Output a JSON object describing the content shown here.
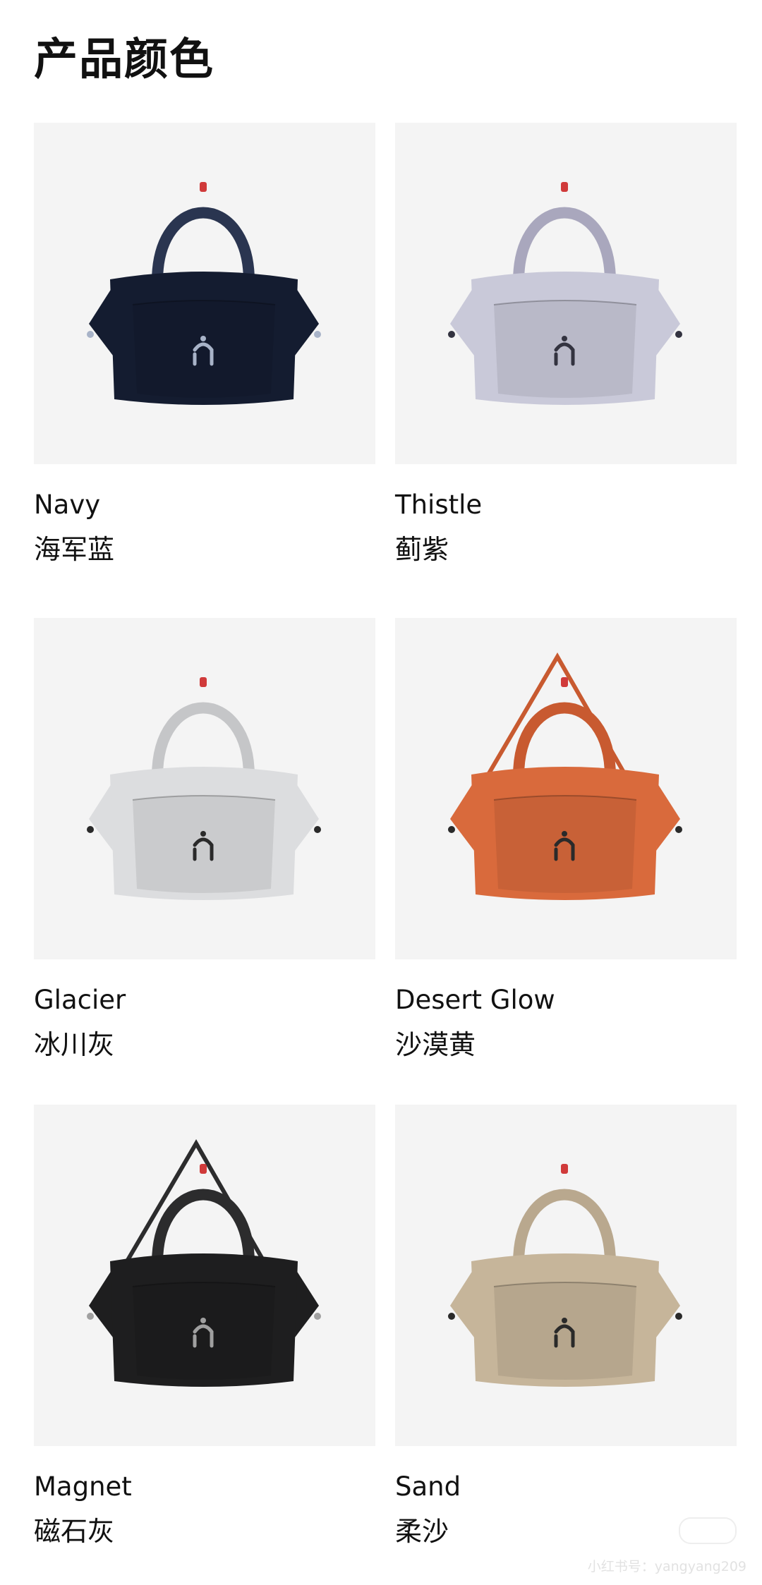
{
  "page": {
    "title": "产品颜色"
  },
  "colors": [
    {
      "name_en": "Navy",
      "name_cn": "海军蓝",
      "icon": "tote-bag-icon",
      "bag_color": "#141c30",
      "handle_color": "#2a3550",
      "accent_color": "#a8b3c8",
      "strap": false
    },
    {
      "name_en": "Thistle",
      "name_cn": "蓟紫",
      "icon": "tote-bag-icon",
      "bag_color": "#c9c9d9",
      "handle_color": "#a9a7bd",
      "accent_color": "#333340",
      "strap": false
    },
    {
      "name_en": "Glacier",
      "name_cn": "冰川灰",
      "icon": "tote-bag-icon",
      "bag_color": "#dcdddf",
      "handle_color": "#c5c6c8",
      "accent_color": "#2a2a2a",
      "strap": false
    },
    {
      "name_en": "Desert Glow",
      "name_cn": "沙漠黄",
      "icon": "tote-bag-icon",
      "bag_color": "#d96a3c",
      "handle_color": "#c85a30",
      "accent_color": "#2a2a2a",
      "strap": true
    },
    {
      "name_en": "Magnet",
      "name_cn": "磁石灰",
      "icon": "tote-bag-icon",
      "bag_color": "#1e1e1f",
      "handle_color": "#2c2c2d",
      "accent_color": "#a0a0a0",
      "strap": true
    },
    {
      "name_en": "Sand",
      "name_cn": "柔沙",
      "icon": "tote-bag-icon",
      "bag_color": "#c6b59a",
      "handle_color": "#b9a88e",
      "accent_color": "#2a2a2a",
      "strap": false
    }
  ],
  "watermark": {
    "text": "小红书号：yangyang209"
  }
}
